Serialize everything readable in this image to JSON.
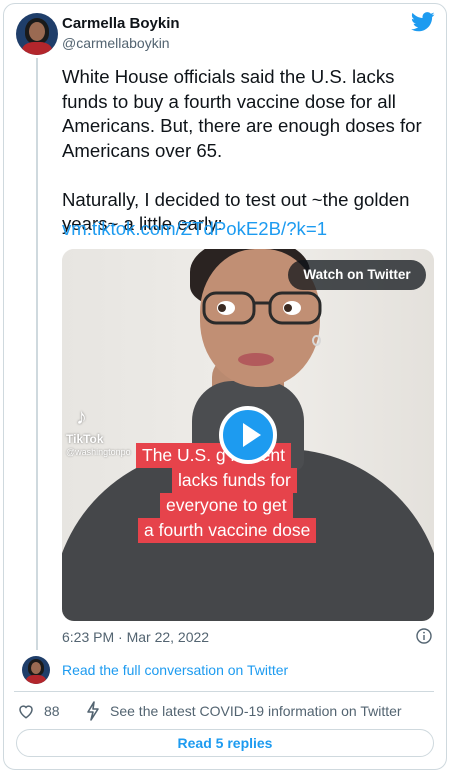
{
  "author": {
    "name": "Carmella Boykin",
    "handle": "@carmellaboykin"
  },
  "tweet": {
    "text": "White House officials said the U.S. lacks funds to buy a fourth vaccine dose for all Americans. But, there are enough doses for Americans over 65.\n\nNaturally, I decided to test out ~the golden years~ a little early:",
    "link": "vm.tiktok.com/ZTdPokE2B/?k=1"
  },
  "media": {
    "watch_label": "Watch on Twitter",
    "tiktok_label": "TikTok",
    "tiktok_user": "@washingtonpo",
    "caption_lines": [
      "The U.S. g     rnment",
      "lacks funds for",
      "everyone to get",
      "a fourth vaccine dose"
    ]
  },
  "meta": {
    "timestamp": "6:23 PM · Mar 22, 2022"
  },
  "conversation_link": "Read the full conversation on Twitter",
  "actions": {
    "likes": "88",
    "covid_info": "See the latest COVID-19 information on Twitter",
    "replies_button": "Read 5 replies"
  },
  "colors": {
    "accent": "#1d9bf0",
    "caption_bg": "#e6434b",
    "secondary_text": "#536471",
    "border": "#cfd9de"
  },
  "icons": {
    "brand": "twitter-bird-icon",
    "info": "info-icon",
    "like": "heart-icon",
    "covid": "bolt-icon",
    "play": "play-icon",
    "tiktok": "tiktok-icon"
  }
}
